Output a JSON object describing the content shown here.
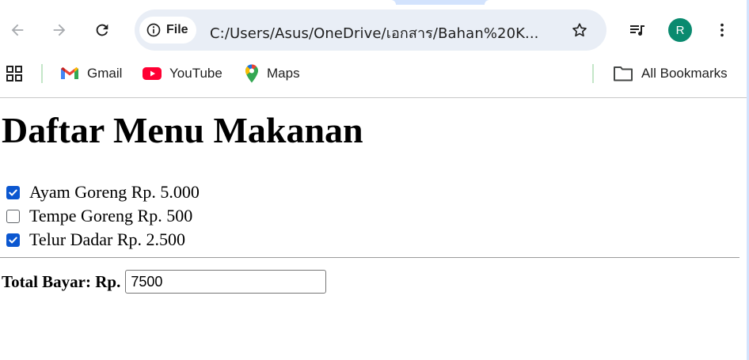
{
  "toolbar": {
    "back_icon": "arrow-left-icon",
    "forward_icon": "arrow-right-icon",
    "reload_icon": "reload-icon",
    "site_chip_label": "File",
    "url": "C:/Users/Asus/OneDrive/เอกสาร/Bahan%20K...",
    "bookmark_star_icon": "star-icon",
    "media_icon": "media-queue-icon",
    "profile_initial": "R",
    "menu_icon": "kebab-menu-icon"
  },
  "bookmarks": {
    "apps_icon": "apps-grid-icon",
    "items": [
      {
        "label": "Gmail",
        "icon": "gmail-icon"
      },
      {
        "label": "YouTube",
        "icon": "youtube-icon"
      },
      {
        "label": "Maps",
        "icon": "maps-icon"
      }
    ],
    "all_bookmarks_label": "All Bookmarks",
    "all_bookmarks_icon": "folder-icon"
  },
  "page": {
    "title": "Daftar Menu Makanan",
    "menu_items": [
      {
        "label": "Ayam Goreng Rp. 5.000",
        "checked": true
      },
      {
        "label": "Tempe Goreng Rp. 500",
        "checked": false
      },
      {
        "label": "Telur Dadar Rp. 2.500",
        "checked": true
      }
    ],
    "total_label": "Total Bayar: Rp.",
    "total_value": "7500"
  },
  "colors": {
    "accent": "#0b57d0",
    "omnibox_bg": "#e9eef6",
    "avatar_bg": "#0a8a6f",
    "tabstrip": "#d3e3fd"
  }
}
